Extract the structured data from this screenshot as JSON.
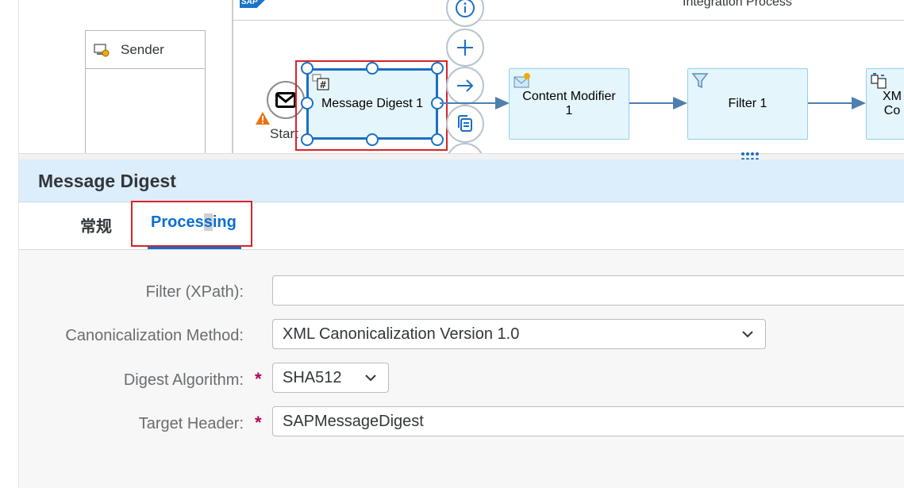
{
  "diagram": {
    "process_title": "Integration Process",
    "sap_logo": "SAP",
    "sender_label": "Sender",
    "start_label": "Start",
    "steps": {
      "message_digest": "Message Digest 1",
      "content_modifier_line1": "Content Modifier",
      "content_modifier_line2": "1",
      "filter": "Filter 1",
      "xml_line1": "XM",
      "xml_line2": "Co"
    }
  },
  "panel": {
    "title": "Message Digest",
    "tabs": {
      "general": "常规",
      "processing_a": "Proces",
      "processing_b": "s",
      "processing_c": "ing"
    }
  },
  "form": {
    "filter_label": "Filter (XPath):",
    "filter_value": "",
    "canon_label": "Canonicalization Method:",
    "canon_value": "XML Canonicalization Version 1.0",
    "digest_label": "Digest Algorithm:",
    "digest_value": "SHA512",
    "target_label": "Target Header:",
    "target_value": "SAPMessageDigest",
    "required_mark": "*"
  },
  "colors": {
    "accent": "#0a6ed1",
    "selection_frame": "#d8232a",
    "step_fill": "#e5f5fc",
    "panel_header": "#dcedfb",
    "required": "#b0005e"
  }
}
